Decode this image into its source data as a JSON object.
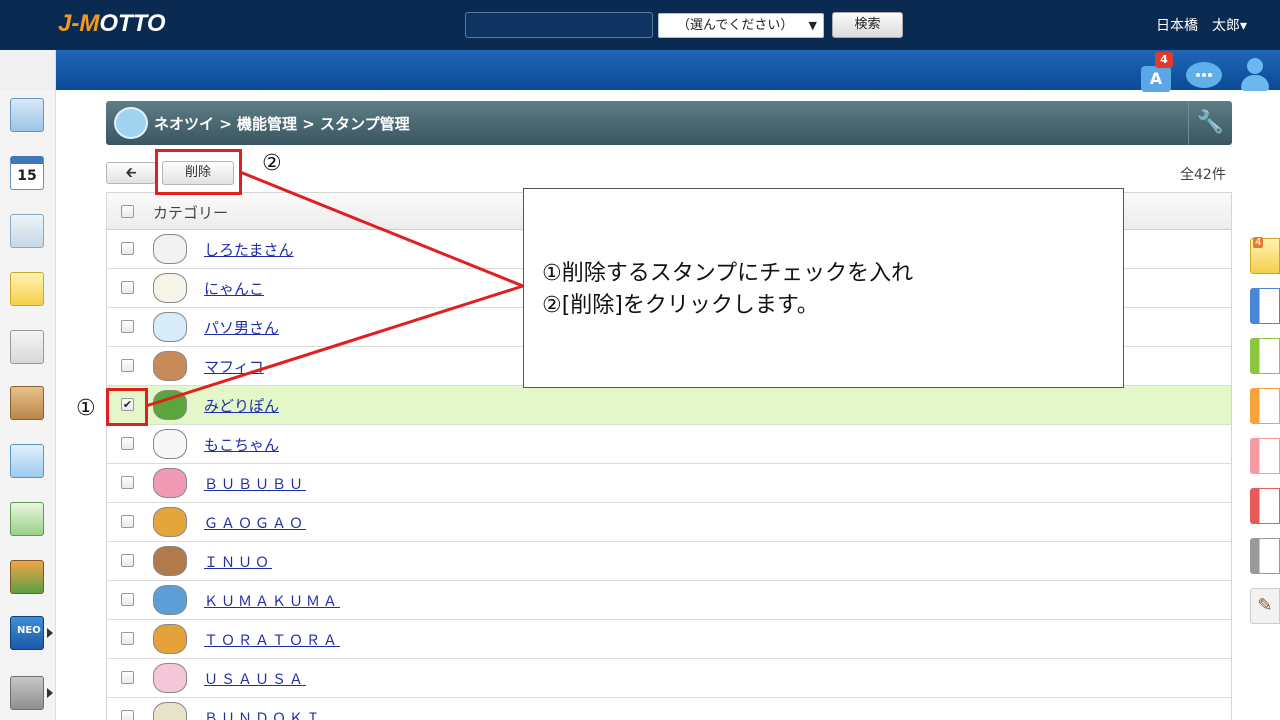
{
  "header": {
    "logo_text": "J-MOTTO",
    "search_value": "",
    "select_value": "（選んでください）",
    "search_button": "検索",
    "user_name": "日本橋　太郎▾",
    "notification_badge": "4",
    "colors": {
      "header_bg": "#0b2a52",
      "band_bg": "#1f66b8"
    }
  },
  "icons": {
    "header": [
      "antenna-icon",
      "chat-icon",
      "user-icon"
    ],
    "sidebar": [
      "portal-icon",
      "calendar-icon",
      "facility-icon",
      "memo-icon",
      "bulletin-icon",
      "clipboard-icon",
      "approval-icon",
      "workflow-icon",
      "cabinet-icon",
      "neo-icon",
      "folder-icon"
    ]
  },
  "sidebar": {
    "calendar_day": "15",
    "neo_label": "NEO"
  },
  "right_sidebar": {
    "badge": "4",
    "tab_colors": [
      "#4a86d6",
      "#8cc63f",
      "#f5a33a",
      "#f59aa0",
      "#e85a5a",
      "#9a9a9a"
    ]
  },
  "page": {
    "title": "ネオツイ > 機能管理 > スタンプ管理",
    "back_symbol": "🡰",
    "delete_button": "削除",
    "count": "全42件"
  },
  "table": {
    "header": "カテゴリー",
    "rows": [
      {
        "name": "しろたまさん",
        "checked": false,
        "color": "#f2f2f2"
      },
      {
        "name": "にゃんこ",
        "checked": false,
        "color": "#f7f4ea"
      },
      {
        "name": "パソ男さん",
        "checked": false,
        "color": "#d8ecfa"
      },
      {
        "name": "マフィコ",
        "checked": false,
        "color": "#c98a5a"
      },
      {
        "name": "みどりぽん",
        "checked": true,
        "color": "#5aa63a"
      },
      {
        "name": "もこちゃん",
        "checked": false,
        "color": "#f7f7f7"
      },
      {
        "name": "ＢＵＢＵＢＵ",
        "checked": false,
        "color": "#f19ab6"
      },
      {
        "name": "ＧＡＯＧＡＯ",
        "checked": false,
        "color": "#e4a53a"
      },
      {
        "name": "ＩＮＵＯ",
        "checked": false,
        "color": "#b07a4a"
      },
      {
        "name": "ＫＵＭＡＫＵＭＡ",
        "checked": false,
        "color": "#5e9ed8"
      },
      {
        "name": "ＴＯＲＡＴＯＲＡ",
        "checked": false,
        "color": "#e6a23a"
      },
      {
        "name": "ＵＳＡＵＳＡ",
        "checked": false,
        "color": "#f4c6d8"
      },
      {
        "name": "ＢＵＮＤＯＫＩ",
        "checked": false,
        "color": "#e8e2c8"
      }
    ]
  },
  "annotation": {
    "line1": "①削除するスタンプにチェックを入れ",
    "line2": "②[削除]をクリックします。",
    "marker1": "①",
    "marker2": "②",
    "color": "#e02020"
  }
}
